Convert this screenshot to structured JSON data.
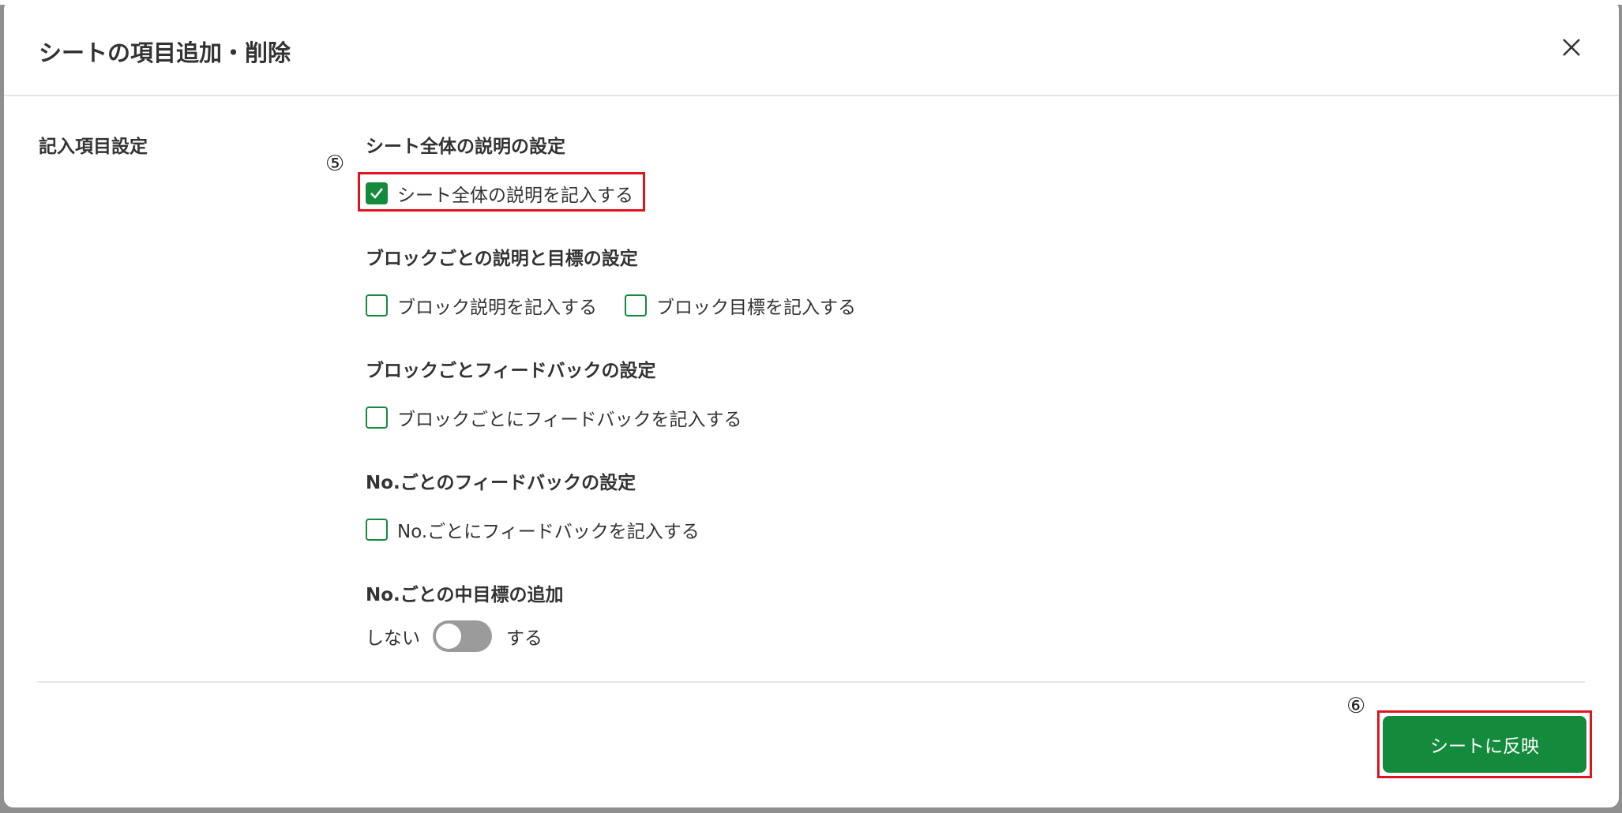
{
  "dialog": {
    "title": "シートの項目追加・削除",
    "close_icon": "close-icon"
  },
  "section": {
    "label": "記入項目設定"
  },
  "groups": [
    {
      "title": "シート全体の説明の設定",
      "options": [
        {
          "label": "シート全体の説明を記入する",
          "checked": true
        }
      ]
    },
    {
      "title": "ブロックごとの説明と目標の設定",
      "options": [
        {
          "label": "ブロック説明を記入する",
          "checked": false
        },
        {
          "label": "ブロック目標を記入する",
          "checked": false
        }
      ]
    },
    {
      "title": "ブロックごとフィードバックの設定",
      "options": [
        {
          "label": "ブロックごとにフィードバックを記入する",
          "checked": false
        }
      ]
    },
    {
      "title": "No.ごとのフィードバックの設定",
      "options": [
        {
          "label": "No.ごとにフィードバックを記入する",
          "checked": false
        }
      ]
    },
    {
      "title": "No.ごとの中目標の追加",
      "toggle": {
        "off_label": "しない",
        "on_label": "する",
        "on": false
      }
    }
  ],
  "annotations": {
    "marker_5": "⑤",
    "marker_6": "⑥"
  },
  "footer": {
    "submit_label": "シートに反映"
  },
  "colors": {
    "accent": "#148a3c",
    "highlight": "#e0141e",
    "toggle_off": "#9b9b9b"
  }
}
